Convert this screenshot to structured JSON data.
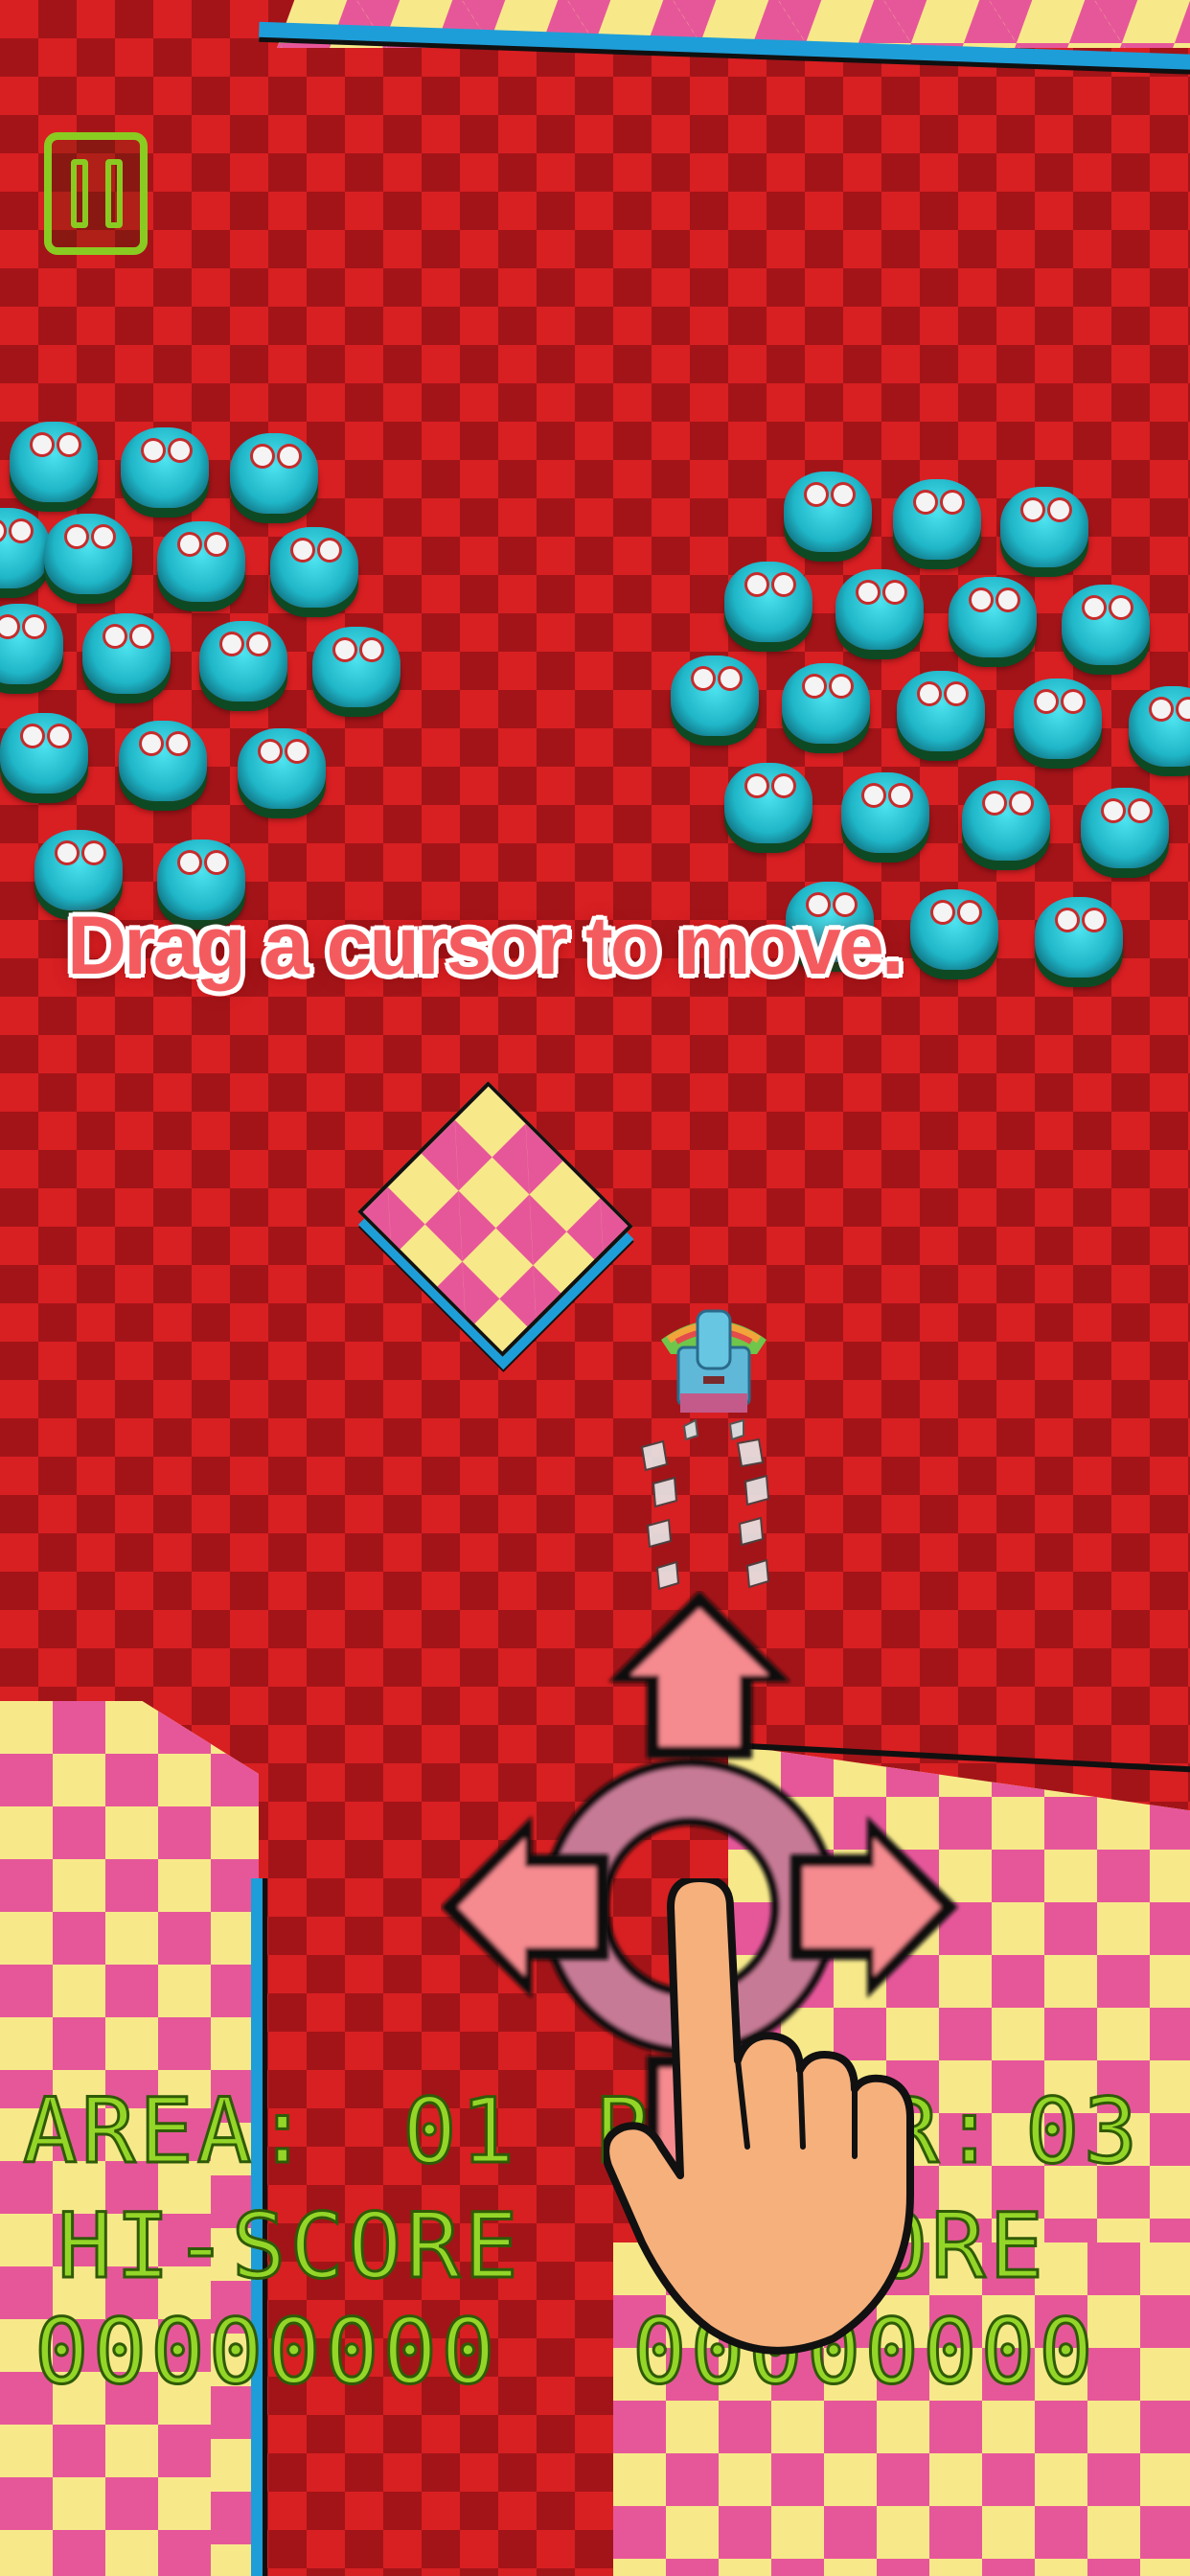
{
  "hint": {
    "text": "Drag a cursor to move."
  },
  "hud": {
    "area_label": "AREA:",
    "area_value": "01",
    "player_label": "PLAYER:",
    "player_value": "03",
    "hiscore_label": "HI-SCORE",
    "score_label": "SCORE",
    "hiscore_value": "00000000",
    "score_value": "00000000"
  },
  "colors": {
    "floor_red": "#d81f22",
    "floor_dark_red": "#a31418",
    "check_yellow": "#f7e98a",
    "check_pink": "#e6579a",
    "edge_blue": "#1e9ed8",
    "hud_green": "#94d628",
    "arrow_pink": "#f58a8f"
  },
  "icons": {
    "pause": "pause-icon",
    "arrow_up": "arrow-up-icon",
    "arrow_left": "arrow-left-icon",
    "arrow_right": "arrow-right-icon",
    "arrow_down": "arrow-down-icon",
    "hand": "pointing-hand-icon"
  }
}
